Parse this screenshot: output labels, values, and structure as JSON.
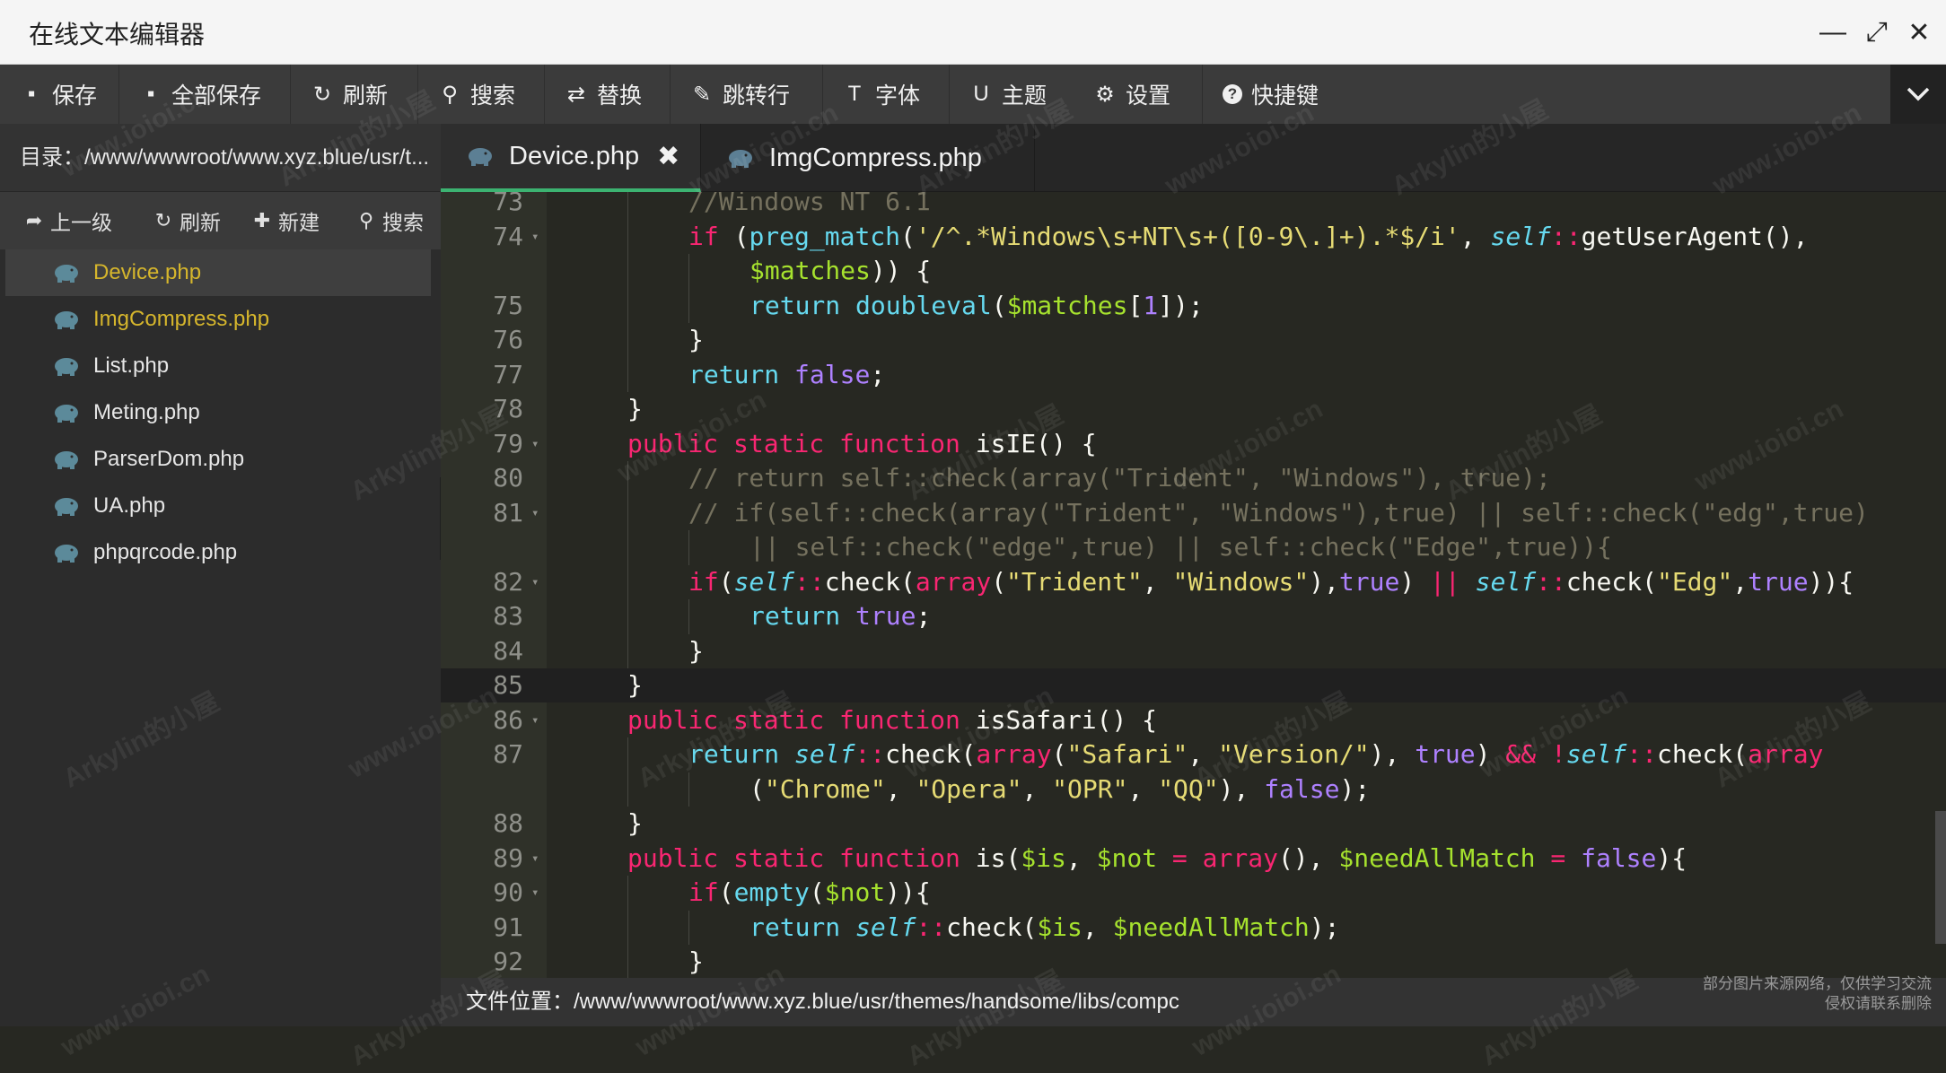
{
  "app": {
    "title": "在线文本编辑器"
  },
  "window_controls": [
    {
      "icon": "minimize-icon",
      "glyph": "—"
    },
    {
      "icon": "maximize-icon",
      "glyph": "⤢"
    },
    {
      "icon": "close-icon",
      "glyph": "✕"
    }
  ],
  "toolbar": {
    "items": [
      {
        "label": "保存",
        "icon": "save-icon",
        "glyph": "▪"
      },
      {
        "label": "全部保存",
        "icon": "save-all-icon",
        "glyph": "▪"
      },
      {
        "label": "刷新",
        "icon": "refresh-icon",
        "glyph": "↻"
      },
      {
        "label": "搜索",
        "icon": "search-icon",
        "glyph": "⚲"
      },
      {
        "label": "替换",
        "icon": "replace-icon",
        "glyph": "⇄"
      },
      {
        "label": "跳转行",
        "icon": "pin-icon",
        "glyph": "✎"
      },
      {
        "label": "字体",
        "icon": "font-icon",
        "glyph": "T"
      },
      {
        "label": "主题",
        "icon": "magnet-icon",
        "glyph": "U"
      },
      {
        "label": "设置",
        "icon": "gear-icon",
        "glyph": "⚙"
      },
      {
        "label": "快捷键",
        "icon": "question-icon",
        "glyph": "?"
      }
    ],
    "more_icon": "chevron-down-icon"
  },
  "sidebar": {
    "path": "目录：/www/wwwroot/www.xyz.blue/usr/t...",
    "actions": [
      {
        "label": "上一级",
        "icon": "share-icon",
        "glyph": "➦"
      },
      {
        "label": "刷新",
        "icon": "refresh-icon",
        "glyph": "↻"
      },
      {
        "label": "新建",
        "icon": "plus-icon",
        "glyph": "✚"
      },
      {
        "label": "搜索",
        "icon": "search-icon",
        "glyph": "⚲"
      }
    ],
    "files": [
      {
        "name": "Device.php",
        "active": true,
        "highlight": true
      },
      {
        "name": "ImgCompress.php",
        "active": false,
        "highlight": true
      },
      {
        "name": "List.php",
        "active": false,
        "highlight": false
      },
      {
        "name": "Meting.php",
        "active": false,
        "highlight": false
      },
      {
        "name": "ParserDom.php",
        "active": false,
        "highlight": false
      },
      {
        "name": "UA.php",
        "active": false,
        "highlight": false
      },
      {
        "name": "phpqrcode.php",
        "active": false,
        "highlight": false
      }
    ],
    "collapse_glyph": "‹"
  },
  "tabs": [
    {
      "label": "Device.php",
      "active": true,
      "close": "✖"
    },
    {
      "label": "ImgCompress.php",
      "active": false
    }
  ],
  "editor": {
    "theme_colors": {
      "bg": "#272822",
      "keyword": "#f92672",
      "string": "#e6db74",
      "comment": "#75715e",
      "variable": "#a6e22e",
      "builtin": "#66d9ef",
      "constant": "#ae81ff"
    },
    "current_line": "85",
    "lines": [
      {
        "n": "73",
        "fold": "",
        "indent": 2,
        "tokens": [
          [
            "c",
            "//Windows NT 6.1"
          ]
        ]
      },
      {
        "n": "74",
        "fold": "▾",
        "indent": 2,
        "tokens": [
          [
            "k",
            "if"
          ],
          [
            "p",
            " ("
          ],
          [
            "b",
            "preg_match"
          ],
          [
            "p",
            "("
          ],
          [
            "s",
            "'/^.*Windows\\s+NT\\s+([0-9\\.]+).*$/i'"
          ],
          [
            "p",
            ", "
          ],
          [
            "i",
            "self"
          ],
          [
            "k",
            "::"
          ],
          [
            "p",
            "getUserAgent(),"
          ]
        ]
      },
      {
        "n": "",
        "fold": "",
        "indent": 3,
        "tokens": [
          [
            "v",
            "$matches"
          ],
          [
            "p",
            ")) {"
          ]
        ]
      },
      {
        "n": "75",
        "fold": "",
        "indent": 3,
        "tokens": [
          [
            "b",
            "return"
          ],
          [
            "p",
            " "
          ],
          [
            "b",
            "doubleval"
          ],
          [
            "p",
            "("
          ],
          [
            "v",
            "$matches"
          ],
          [
            "p",
            "["
          ],
          [
            "n",
            "1"
          ],
          [
            "p",
            "]);"
          ]
        ]
      },
      {
        "n": "76",
        "fold": "",
        "indent": 2,
        "tokens": [
          [
            "p",
            "}"
          ]
        ]
      },
      {
        "n": "77",
        "fold": "",
        "indent": 2,
        "tokens": [
          [
            "b",
            "return"
          ],
          [
            "p",
            " "
          ],
          [
            "n",
            "false"
          ],
          [
            "p",
            ";"
          ]
        ]
      },
      {
        "n": "78",
        "fold": "",
        "indent": 1,
        "tokens": [
          [
            "p",
            "}"
          ]
        ]
      },
      {
        "n": "79",
        "fold": "▾",
        "indent": 1,
        "tokens": [
          [
            "k",
            "public"
          ],
          [
            "p",
            " "
          ],
          [
            "k",
            "static"
          ],
          [
            "p",
            " "
          ],
          [
            "k",
            "function"
          ],
          [
            "p",
            " isIE() {"
          ]
        ]
      },
      {
        "n": "80",
        "fold": "",
        "indent": 2,
        "tokens": [
          [
            "c",
            "// return self::check(array(\"Trident\", \"Windows\"), true);"
          ]
        ]
      },
      {
        "n": "81",
        "fold": "▾",
        "indent": 2,
        "tokens": [
          [
            "c",
            "// if(self::check(array(\"Trident\", \"Windows\"),true) || self::check(\"edg\",true)"
          ]
        ]
      },
      {
        "n": "",
        "fold": "",
        "indent": 3,
        "tokens": [
          [
            "c",
            "|| self::check(\"edge\",true) || self::check(\"Edge\",true)){"
          ]
        ]
      },
      {
        "n": "82",
        "fold": "▾",
        "indent": 2,
        "tokens": [
          [
            "k",
            "if"
          ],
          [
            "p",
            "("
          ],
          [
            "i",
            "self"
          ],
          [
            "k",
            "::"
          ],
          [
            "p",
            "check("
          ],
          [
            "k",
            "array"
          ],
          [
            "p",
            "("
          ],
          [
            "s",
            "\"Trident\""
          ],
          [
            "p",
            ", "
          ],
          [
            "s",
            "\"Windows\""
          ],
          [
            "p",
            "),"
          ],
          [
            "n",
            "true"
          ],
          [
            "p",
            ") "
          ],
          [
            "k",
            "||"
          ],
          [
            "p",
            " "
          ],
          [
            "i",
            "self"
          ],
          [
            "k",
            "::"
          ],
          [
            "p",
            "check("
          ],
          [
            "s",
            "\"Edg\""
          ],
          [
            "p",
            ","
          ],
          [
            "n",
            "true"
          ],
          [
            "p",
            ")){"
          ]
        ]
      },
      {
        "n": "83",
        "fold": "",
        "indent": 3,
        "tokens": [
          [
            "b",
            "return"
          ],
          [
            "p",
            " "
          ],
          [
            "n",
            "true"
          ],
          [
            "p",
            ";"
          ]
        ]
      },
      {
        "n": "84",
        "fold": "",
        "indent": 2,
        "tokens": [
          [
            "p",
            "}"
          ]
        ]
      },
      {
        "n": "85",
        "fold": "",
        "indent": 1,
        "tokens": [
          [
            "p",
            "}"
          ]
        ]
      },
      {
        "n": "86",
        "fold": "▾",
        "indent": 1,
        "tokens": [
          [
            "k",
            "public"
          ],
          [
            "p",
            " "
          ],
          [
            "k",
            "static"
          ],
          [
            "p",
            " "
          ],
          [
            "k",
            "function"
          ],
          [
            "p",
            " isSafari() {"
          ]
        ]
      },
      {
        "n": "87",
        "fold": "",
        "indent": 2,
        "tokens": [
          [
            "b",
            "return"
          ],
          [
            "p",
            " "
          ],
          [
            "i",
            "self"
          ],
          [
            "k",
            "::"
          ],
          [
            "p",
            "check("
          ],
          [
            "k",
            "array"
          ],
          [
            "p",
            "("
          ],
          [
            "s",
            "\"Safari\""
          ],
          [
            "p",
            ", "
          ],
          [
            "s",
            "\"Version/\""
          ],
          [
            "p",
            "), "
          ],
          [
            "n",
            "true"
          ],
          [
            "p",
            ") "
          ],
          [
            "k",
            "&&"
          ],
          [
            "p",
            " "
          ],
          [
            "k",
            "!"
          ],
          [
            "i",
            "self"
          ],
          [
            "k",
            "::"
          ],
          [
            "p",
            "check("
          ],
          [
            "k",
            "array"
          ]
        ]
      },
      {
        "n": "",
        "fold": "",
        "indent": 3,
        "tokens": [
          [
            "p",
            "("
          ],
          [
            "s",
            "\"Chrome\""
          ],
          [
            "p",
            ", "
          ],
          [
            "s",
            "\"Opera\""
          ],
          [
            "p",
            ", "
          ],
          [
            "s",
            "\"OPR\""
          ],
          [
            "p",
            ", "
          ],
          [
            "s",
            "\"QQ\""
          ],
          [
            "p",
            "), "
          ],
          [
            "n",
            "false"
          ],
          [
            "p",
            ");"
          ]
        ]
      },
      {
        "n": "88",
        "fold": "",
        "indent": 1,
        "tokens": [
          [
            "p",
            "}"
          ]
        ]
      },
      {
        "n": "89",
        "fold": "▾",
        "indent": 1,
        "tokens": [
          [
            "k",
            "public"
          ],
          [
            "p",
            " "
          ],
          [
            "k",
            "static"
          ],
          [
            "p",
            " "
          ],
          [
            "k",
            "function"
          ],
          [
            "p",
            " is("
          ],
          [
            "v",
            "$is"
          ],
          [
            "p",
            ", "
          ],
          [
            "v",
            "$not"
          ],
          [
            "p",
            " "
          ],
          [
            "k",
            "="
          ],
          [
            "p",
            " "
          ],
          [
            "k",
            "array"
          ],
          [
            "p",
            "(), "
          ],
          [
            "v",
            "$needAllMatch"
          ],
          [
            "p",
            " "
          ],
          [
            "k",
            "="
          ],
          [
            "p",
            " "
          ],
          [
            "n",
            "false"
          ],
          [
            "p",
            "){"
          ]
        ]
      },
      {
        "n": "90",
        "fold": "▾",
        "indent": 2,
        "tokens": [
          [
            "k",
            "if"
          ],
          [
            "p",
            "("
          ],
          [
            "b",
            "empty"
          ],
          [
            "p",
            "("
          ],
          [
            "v",
            "$not"
          ],
          [
            "p",
            ")){"
          ]
        ]
      },
      {
        "n": "91",
        "fold": "",
        "indent": 3,
        "tokens": [
          [
            "b",
            "return"
          ],
          [
            "p",
            " "
          ],
          [
            "i",
            "self"
          ],
          [
            "k",
            "::"
          ],
          [
            "p",
            "check("
          ],
          [
            "v",
            "$is"
          ],
          [
            "p",
            ", "
          ],
          [
            "v",
            "$needAllMatch"
          ],
          [
            "p",
            ");"
          ]
        ]
      },
      {
        "n": "92",
        "fold": "",
        "indent": 2,
        "tokens": [
          [
            "p",
            "}"
          ]
        ]
      }
    ]
  },
  "status": {
    "file_location": "文件位置：/www/wwwroot/www.xyz.blue/usr/themes/handsome/libs/compc"
  },
  "notice": {
    "line1": "部分图片来源网络，仅供学习交流",
    "line2": "侵权请联系删除"
  },
  "watermarks": [
    "www.ioioi.cn",
    "Arkylin的小屋"
  ]
}
